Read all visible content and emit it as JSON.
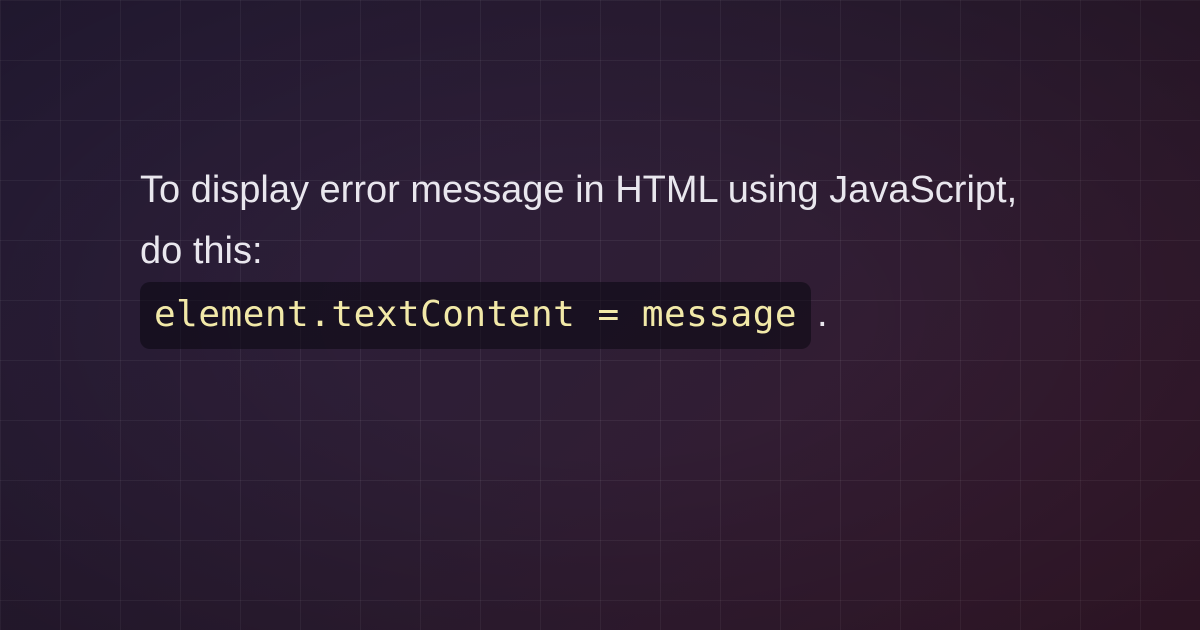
{
  "content": {
    "intro": "To display error message in HTML using JavaScript, do this:",
    "code": "element.textContent = message",
    "period": "."
  }
}
